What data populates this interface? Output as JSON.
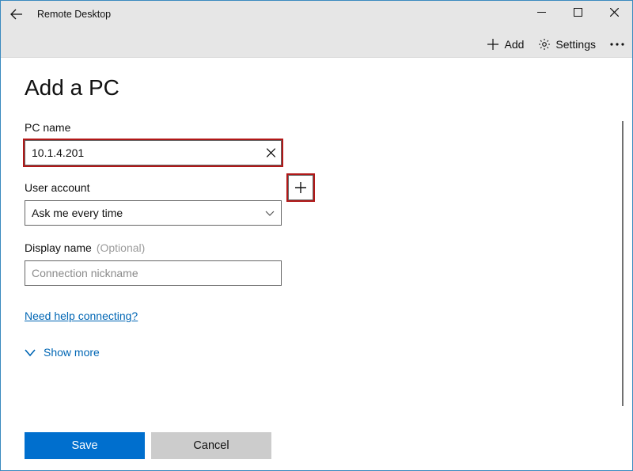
{
  "window": {
    "title": "Remote Desktop"
  },
  "toolbar": {
    "add_label": "Add",
    "settings_label": "Settings"
  },
  "page": {
    "title": "Add a PC"
  },
  "pcname": {
    "label": "PC name",
    "value": "10.1.4.201"
  },
  "useraccount": {
    "label": "User account",
    "selected": "Ask me every time"
  },
  "displayname": {
    "label": "Display name",
    "optional": "(Optional)",
    "placeholder": "Connection nickname"
  },
  "help_link": "Need help connecting?",
  "showmore_label": "Show more",
  "footer": {
    "save": "Save",
    "cancel": "Cancel"
  }
}
